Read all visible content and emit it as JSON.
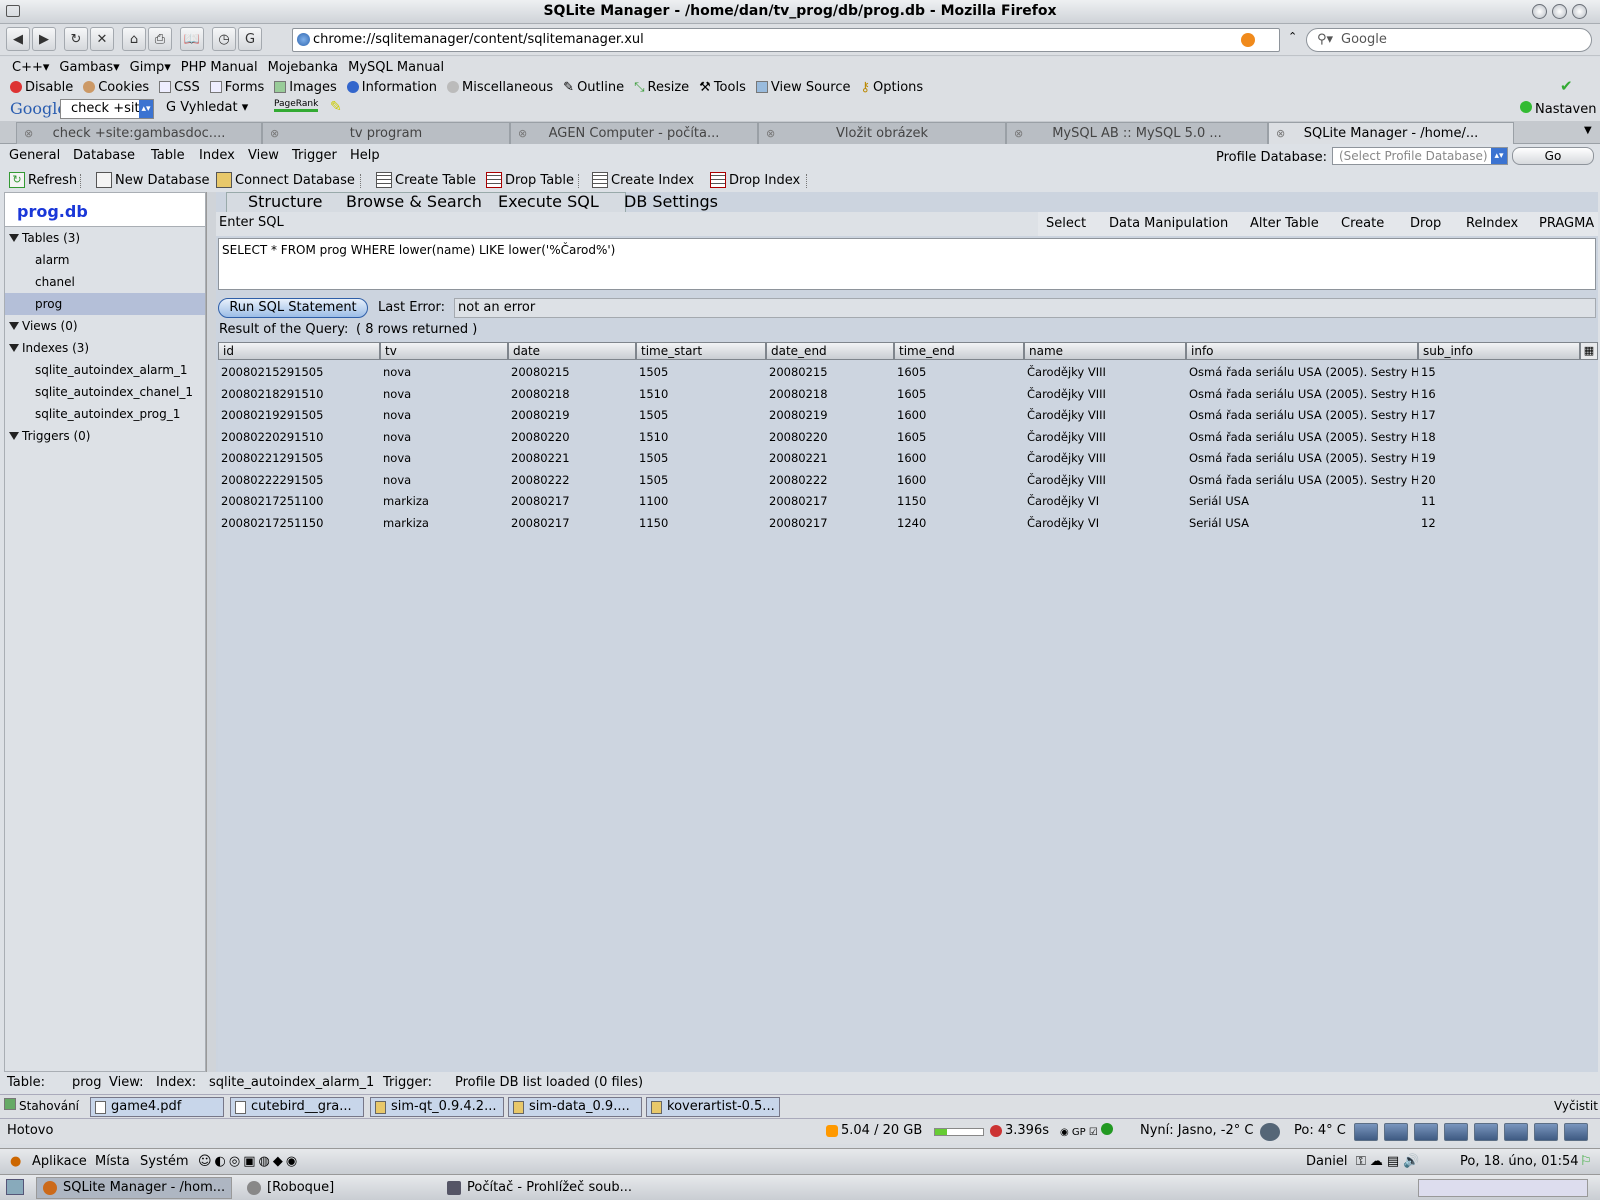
{
  "window": {
    "title": "SQLite Manager - /home/dan/tv_prog/db/prog.db - Mozilla Firefox"
  },
  "nav": {
    "url": "chrome://sqlitemanager/content/sqlitemanager.xul",
    "search_placeholder": "Google"
  },
  "bookmarks": [
    "C++",
    "Gambas",
    "Gimp",
    "PHP Manual",
    "Mojebanka",
    "MySQL Manual"
  ],
  "devtools": [
    "Disable",
    "Cookies",
    "CSS",
    "Forms",
    "Images",
    "Information",
    "Miscellaneous",
    "Outline",
    "Resize",
    "Tools",
    "View Source",
    "Options"
  ],
  "googlebar": {
    "logo": "Google",
    "query": "check +sit",
    "search_label": "Vyhledat",
    "pagerank": "PageRank",
    "settings": "Nastaven"
  },
  "tabs": [
    "check +site:gambasdoc....",
    "tv program",
    "AGEN Computer - počíta...",
    "Vložit obrázek",
    "MySQL AB :: MySQL 5.0 ...",
    "SQLite Manager - /home/..."
  ],
  "app": {
    "menu": [
      "General",
      "Database",
      "Table",
      "Index",
      "View",
      "Trigger",
      "Help"
    ],
    "profile_label": "Profile Database:",
    "profile_placeholder": "(Select Profile Database)",
    "go_label": "Go",
    "toolbar": [
      "Refresh",
      "New Database",
      "Connect Database",
      "Create Table",
      "Drop Table",
      "Create  Index",
      "Drop  Index"
    ],
    "db_name": "prog.db",
    "tree": {
      "tables_label": "Tables (3)",
      "tables": [
        "alarm",
        "chanel",
        "prog"
      ],
      "views_label": "Views (0)",
      "indexes_label": "Indexes (3)",
      "indexes": [
        "sqlite_autoindex_alarm_1",
        "sqlite_autoindex_chanel_1",
        "sqlite_autoindex_prog_1"
      ],
      "triggers_label": "Triggers (0)"
    },
    "pane_tabs": [
      "Structure",
      "Browse & Search",
      "Execute SQL",
      "DB Settings"
    ],
    "enter_sql": "Enter SQL",
    "sql_categories": [
      "Select",
      "Data Manipulation",
      "Alter Table",
      "Create",
      "Drop",
      "ReIndex",
      "PRAGMA"
    ],
    "sql_text": "SELECT * FROM prog WHERE lower(name) LIKE lower('%Čarod%')",
    "run_label": "Run SQL Statement",
    "last_error_label": "Last Error:",
    "last_error_value": "not an error",
    "result_label": "Result of the Query:",
    "result_count": "( 8 rows returned )",
    "columns": [
      "id",
      "tv",
      "date",
      "time_start",
      "date_end",
      "time_end",
      "name",
      "info",
      "sub_info"
    ],
    "rows": [
      [
        "20080215291505",
        "nova",
        "20080215",
        "1505",
        "20080215",
        "1605",
        "Čarodějky VIII",
        "Osmá řada seriálu USA (2005). Sestry H...",
        "15"
      ],
      [
        "20080218291510",
        "nova",
        "20080218",
        "1510",
        "20080218",
        "1605",
        "Čarodějky VIII",
        "Osmá řada seriálu USA (2005). Sestry H...",
        "16"
      ],
      [
        "20080219291505",
        "nova",
        "20080219",
        "1505",
        "20080219",
        "1600",
        "Čarodějky VIII",
        "Osmá řada seriálu USA (2005). Sestry H...",
        "17"
      ],
      [
        "20080220291510",
        "nova",
        "20080220",
        "1510",
        "20080220",
        "1605",
        "Čarodějky VIII",
        "Osmá řada seriálu USA (2005). Sestry H...",
        "18"
      ],
      [
        "20080221291505",
        "nova",
        "20080221",
        "1505",
        "20080221",
        "1600",
        "Čarodějky VIII",
        "Osmá řada seriálu USA (2005). Sestry H...",
        "19"
      ],
      [
        "20080222291505",
        "nova",
        "20080222",
        "1505",
        "20080222",
        "1600",
        "Čarodějky VIII",
        "Osmá řada seriálu USA (2005). Sestry H...",
        "20"
      ],
      [
        "20080217251100",
        "markiza",
        "20080217",
        "1100",
        "20080217",
        "1150",
        "Čarodějky VI",
        "Seriál USA",
        "11"
      ],
      [
        "20080217251150",
        "markiza",
        "20080217",
        "1150",
        "20080217",
        "1240",
        "Čarodějky VI",
        "Seriál USA",
        "12"
      ]
    ],
    "status": {
      "table_label": "Table:",
      "table_value": "prog",
      "view_label": "View:",
      "index_label": "Index:",
      "index_value": "sqlite_autoindex_alarm_1",
      "trigger_label": "Trigger:",
      "message": "Profile DB list loaded (0 files)"
    }
  },
  "downloads": {
    "label": "Stahování",
    "items": [
      "game4.pdf",
      "cutebird__gra...",
      "sim-qt_0.9.4.2...",
      "sim-data_0.9....",
      "koverartist-0.5..."
    ],
    "clear": "Vyčistit"
  },
  "ffstatus": {
    "text": "Hotovo",
    "disk": "5.04 / 20 GB",
    "disk_fill": 0.25,
    "timer": "3.396s",
    "weather_now": "Nyní: Jasno, -2° C",
    "forecast": "Po: 4° C"
  },
  "gnome": {
    "menus": [
      "Aplikace",
      "Místa",
      "Systém"
    ],
    "user": "Daniel",
    "clock": "Po, 18. úno, 01:54",
    "tasks": [
      "SQLite Manager - /hom...",
      "[Roboque]",
      "Počítač - Prohlížeč soub..."
    ]
  }
}
